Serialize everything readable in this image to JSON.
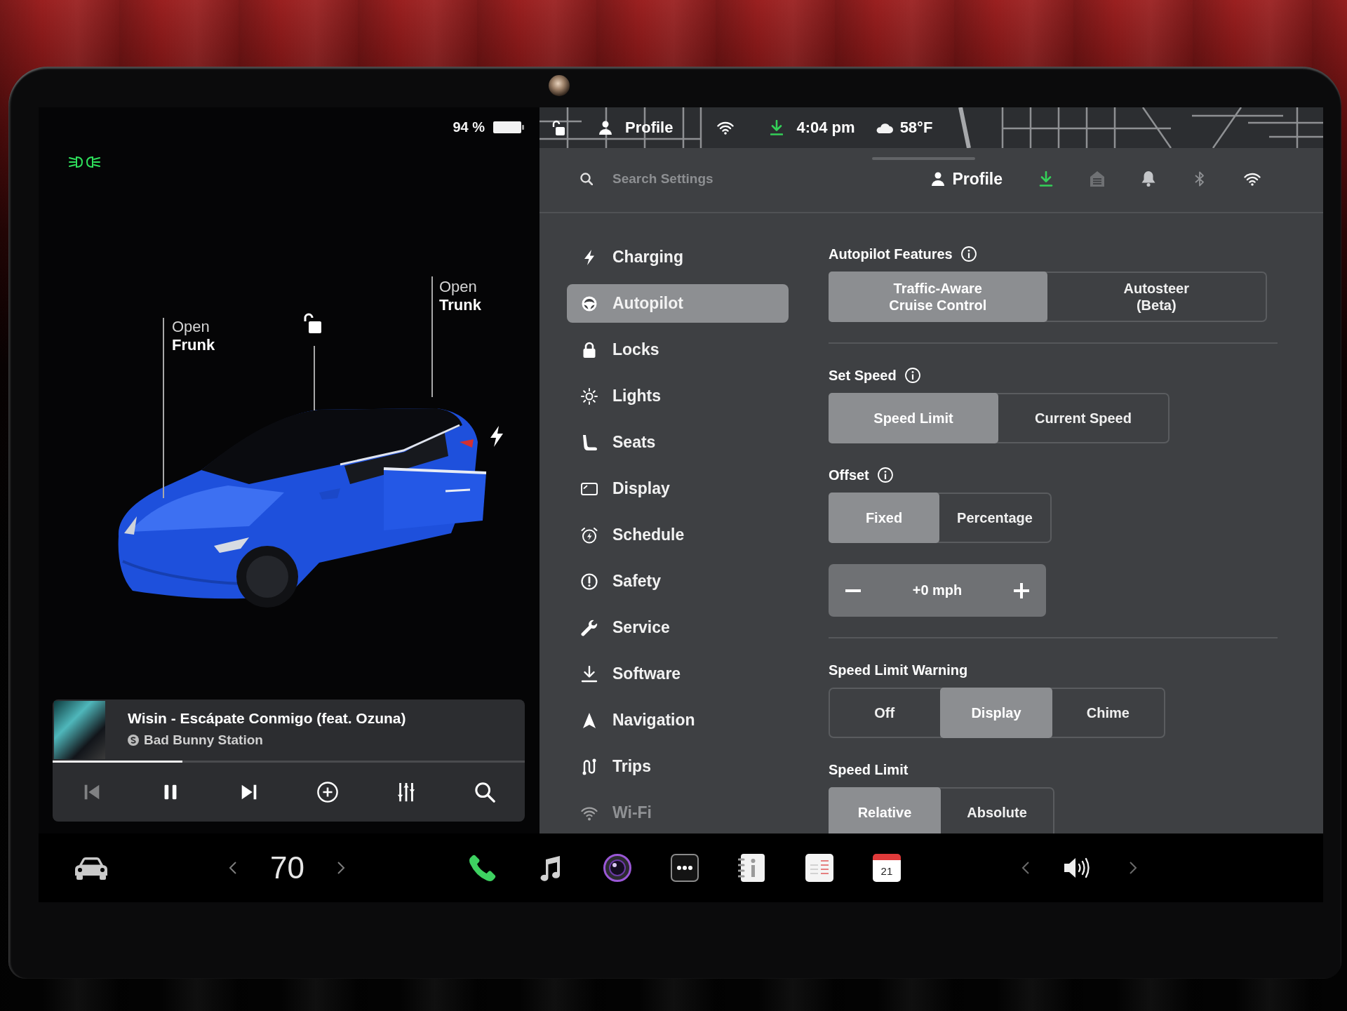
{
  "car_panel": {
    "battery": "94 %",
    "labels": [
      {
        "action": "Open",
        "target": "Frunk"
      },
      {
        "action": "Open",
        "target": "Trunk"
      }
    ]
  },
  "media": {
    "title": "Wisin - Escápate Conmigo (feat. Ozuna)",
    "station": "Bad Bunny Station",
    "progress": {
      "level": 0.275
    },
    "controls": [
      {
        "kind": "previous",
        "disabled": true
      },
      {
        "kind": "pause",
        "disabled": false
      },
      {
        "kind": "next",
        "disabled": false
      },
      {
        "kind": "add",
        "disabled": false
      },
      {
        "kind": "equalizer",
        "disabled": false
      },
      {
        "kind": "search",
        "disabled": false
      }
    ]
  },
  "status_bar": {
    "profile": "Profile",
    "time": "4:04 pm",
    "temperature": "58°F"
  },
  "settings": {
    "search": {
      "placeholder": "Search Settings"
    },
    "profile": "Profile",
    "nav": [
      {
        "label": "Charging",
        "selected": false
      },
      {
        "label": "Autopilot",
        "selected": true
      },
      {
        "label": "Locks",
        "selected": false
      },
      {
        "label": "Lights",
        "selected": false
      },
      {
        "label": "Seats",
        "selected": false
      },
      {
        "label": "Display",
        "selected": false
      },
      {
        "label": "Schedule",
        "selected": false
      },
      {
        "label": "Safety",
        "selected": false
      },
      {
        "label": "Service",
        "selected": false
      },
      {
        "label": "Software",
        "selected": false
      },
      {
        "label": "Navigation",
        "selected": false
      },
      {
        "label": "Trips",
        "selected": false
      },
      {
        "label": "Wi-Fi",
        "selected": false
      }
    ],
    "sections": [
      {
        "title": "Autopilot Features",
        "info": true,
        "controls": [
          {
            "kind": "segmented",
            "options": [
              {
                "label": "Traffic-Aware Cruise Control",
                "selected": true
              },
              {
                "label": "Autosteer (Beta)",
                "selected": false
              }
            ]
          }
        ],
        "divider_after": true
      },
      {
        "title": "Set Speed",
        "info": true,
        "controls": [
          {
            "kind": "segmented",
            "options": [
              {
                "label": "Speed Limit",
                "selected": true
              },
              {
                "label": "Current Speed",
                "selected": false
              }
            ]
          }
        ],
        "divider_after": false
      },
      {
        "title": "Offset",
        "info": true,
        "controls": [
          {
            "kind": "segmented",
            "options": [
              {
                "label": "Fixed",
                "selected": true
              },
              {
                "label": "Percentage",
                "selected": false
              }
            ]
          },
          {
            "kind": "stepper",
            "value": "+0 mph"
          }
        ],
        "divider_after": true
      },
      {
        "title": "Speed Limit Warning",
        "info": false,
        "controls": [
          {
            "kind": "segmented",
            "options": [
              {
                "label": "Off",
                "selected": false
              },
              {
                "label": "Display",
                "selected": true
              },
              {
                "label": "Chime",
                "selected": false
              }
            ]
          }
        ],
        "divider_after": false
      },
      {
        "title": "Speed Limit",
        "info": false,
        "controls": [
          {
            "kind": "segmented",
            "options": [
              {
                "label": "Relative",
                "selected": true
              },
              {
                "label": "Absolute",
                "selected": false
              }
            ]
          }
        ],
        "divider_after": false
      }
    ]
  },
  "bottom_bar": {
    "climate": "70",
    "calendar_day": "21"
  }
}
